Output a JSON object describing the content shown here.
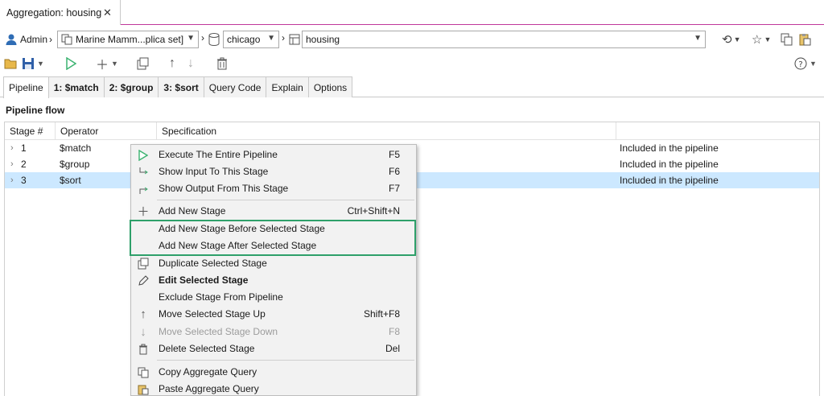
{
  "window": {
    "tab_title": "Aggregation: housing"
  },
  "breadcrumb": {
    "user": "Admin",
    "connection": "Marine Mamm...plica set]",
    "database": "chicago",
    "collection": "housing"
  },
  "tabs": [
    {
      "label": "Pipeline",
      "active": true
    },
    {
      "label": "1: $match"
    },
    {
      "label": "2: $group"
    },
    {
      "label": "3: $sort"
    },
    {
      "label": "Query Code"
    },
    {
      "label": "Explain"
    },
    {
      "label": "Options"
    }
  ],
  "pipeline": {
    "section_title": "Pipeline flow",
    "columns": [
      "Stage #",
      "Operator",
      "Specification"
    ],
    "rows": [
      {
        "stage": "1",
        "operator": "$match",
        "status": "Included in the pipeline"
      },
      {
        "stage": "2",
        "operator": "$group",
        "status": "Included in the pipeline"
      },
      {
        "stage": "3",
        "operator": "$sort",
        "status": "Included in the pipeline"
      }
    ]
  },
  "context_menu": {
    "items": [
      {
        "label": "Execute The Entire Pipeline",
        "shortcut": "F5"
      },
      {
        "label": "Show Input To This Stage",
        "shortcut": "F6"
      },
      {
        "label": "Show Output From This Stage",
        "shortcut": "F7"
      },
      {
        "label": "Add New Stage",
        "shortcut": "Ctrl+Shift+N"
      },
      {
        "label": "Add New Stage Before Selected Stage",
        "shortcut": ""
      },
      {
        "label": "Add New Stage After Selected Stage",
        "shortcut": ""
      },
      {
        "label": "Duplicate Selected Stage",
        "shortcut": ""
      },
      {
        "label": "Edit Selected Stage",
        "shortcut": ""
      },
      {
        "label": "Exclude Stage From Pipeline",
        "shortcut": ""
      },
      {
        "label": "Move Selected Stage Up",
        "shortcut": "Shift+F8"
      },
      {
        "label": "Move Selected Stage Down",
        "shortcut": "F8"
      },
      {
        "label": "Delete Selected Stage",
        "shortcut": "Del"
      },
      {
        "label": "Copy Aggregate Query",
        "shortcut": ""
      },
      {
        "label": "Paste Aggregate Query",
        "shortcut": ""
      }
    ]
  },
  "colors": {
    "selection": "#cce8ff",
    "highlight_border": "#2ea06a",
    "run_green": "#3cb371",
    "accent_tab_line": "#c0389a"
  }
}
